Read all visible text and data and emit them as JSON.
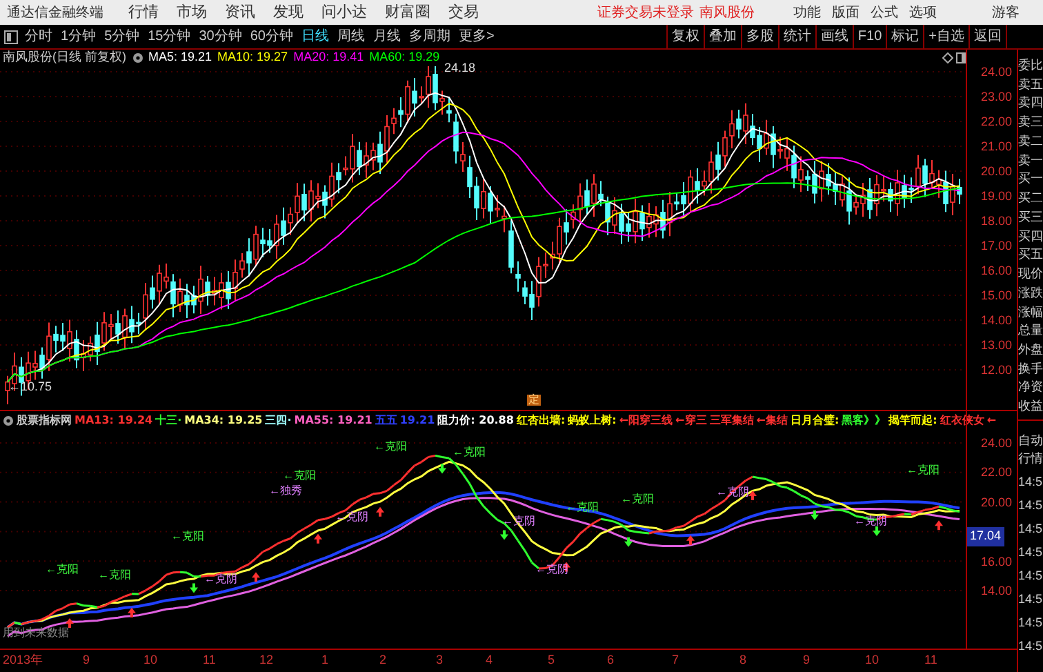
{
  "app": {
    "title": "通达信金融终端",
    "menus": [
      "行情",
      "市场",
      "资讯",
      "发现",
      "问小达",
      "财富圈",
      "交易"
    ],
    "login_notice": "证券交易未登录",
    "stock_link": "南风股份",
    "tools": [
      "功能",
      "版面",
      "公式",
      "选项"
    ],
    "user": "游客"
  },
  "toolbar": {
    "periods": [
      {
        "label": "分时",
        "selected": false
      },
      {
        "label": "1分钟",
        "selected": false
      },
      {
        "label": "5分钟",
        "selected": false
      },
      {
        "label": "15分钟",
        "selected": false
      },
      {
        "label": "30分钟",
        "selected": false
      },
      {
        "label": "60分钟",
        "selected": false
      },
      {
        "label": "日线",
        "selected": true
      },
      {
        "label": "周线",
        "selected": false
      },
      {
        "label": "月线",
        "selected": false
      },
      {
        "label": "多周期",
        "selected": false
      },
      {
        "label": "更多>",
        "selected": false
      }
    ],
    "buttons": [
      "复权",
      "叠加",
      "多股",
      "统计",
      "画线",
      "F10",
      "标记",
      "+自选",
      "返回"
    ]
  },
  "main_chart": {
    "title": "南风股份(日线 前复权)",
    "ma": [
      {
        "label": "MA5: 19.21",
        "color": "#ffffff"
      },
      {
        "label": "MA10: 19.27",
        "color": "#ffff00"
      },
      {
        "label": "MA20: 19.41",
        "color": "#ff00ff"
      },
      {
        "label": "MA60: 19.29",
        "color": "#00ff00"
      }
    ],
    "high_label": "24.18",
    "low_label": "←10.75",
    "marker": "定",
    "price_axis": [
      "24.00",
      "23.00",
      "22.00",
      "21.00",
      "20.00",
      "19.00",
      "18.00",
      "17.00",
      "16.00",
      "15.00",
      "14.00",
      "13.00",
      "12.00"
    ]
  },
  "indicator_chart": {
    "title": "股票指标网",
    "items": [
      {
        "text": "MA13: 19.24",
        "color": "#ff3030"
      },
      {
        "text": "十三·",
        "color": "#30ff30"
      },
      {
        "text": "MA34: 19.25",
        "color": "#ffff80"
      },
      {
        "text": "三四·",
        "color": "#a0ffff"
      },
      {
        "text": "MA55: 19.21",
        "color": "#ff60c0"
      },
      {
        "text": "五五",
        "color": "#3040ff"
      },
      {
        "text": "19.21",
        "color": "#3040ff"
      },
      {
        "text": "阻力价: 20.88",
        "color": "#ffffff"
      },
      {
        "text": "红杏出墙:",
        "color": "#ffff00"
      },
      {
        "text": "蚂蚁上树:",
        "color": "#ffff00"
      },
      {
        "text": "←阳穿三线",
        "color": "#ff3030"
      },
      {
        "text": "←穿三",
        "color": "#ff3030"
      },
      {
        "text": "三军集结",
        "color": "#ff3030"
      },
      {
        "text": "←集结",
        "color": "#ff3030"
      },
      {
        "text": "日月合璧:",
        "color": "#ffff00"
      },
      {
        "text": "黑客》》",
        "color": "#30ff30"
      },
      {
        "text": "揭竿而起:",
        "color": "#ffff00"
      },
      {
        "text": "红衣侠女",
        "color": "#ff3030"
      },
      {
        "text": "←",
        "color": "#ff3030"
      }
    ],
    "labels": [
      {
        "text": "←克阳",
        "kind": "up"
      },
      {
        "text": "←克阳",
        "kind": "up"
      },
      {
        "text": "←克阳",
        "kind": "up"
      },
      {
        "text": "←独秀",
        "kind": "down"
      },
      {
        "text": "←克阳",
        "kind": "up"
      },
      {
        "text": "←克阴",
        "kind": "down"
      },
      {
        "text": "←克阳",
        "kind": "up"
      },
      {
        "text": "←克阳",
        "kind": "up"
      },
      {
        "text": "←克阴",
        "kind": "down"
      },
      {
        "text": "←克阴",
        "kind": "down"
      },
      {
        "text": "←克阴",
        "kind": "down"
      },
      {
        "text": "←克阳",
        "kind": "up"
      },
      {
        "text": "←克阳",
        "kind": "up"
      },
      {
        "text": "←克阴",
        "kind": "down"
      },
      {
        "text": "←克阴",
        "kind": "down"
      },
      {
        "text": "←克阳",
        "kind": "up"
      }
    ],
    "axis": [
      "24.00",
      "22.00",
      "20.00",
      "16.00",
      "14.00"
    ],
    "current_price": "17.04",
    "note": "用到未来数据"
  },
  "time_axis": [
    "2013年",
    "9",
    "10",
    "11",
    "12",
    "1",
    "2",
    "3",
    "4",
    "5",
    "6",
    "7",
    "8",
    "9",
    "10",
    "11"
  ],
  "quote_panel": {
    "fields": [
      "委比",
      "卖五",
      "卖四",
      "卖三",
      "卖二",
      "卖一",
      "买一",
      "买二",
      "买三",
      "买四",
      "买五",
      "现价",
      "涨跌",
      "涨幅",
      "总量",
      "外盘",
      "换手",
      "净资",
      "收益"
    ],
    "modes": [
      "自动",
      "行情"
    ],
    "times": [
      "14:5",
      "14:5",
      "14:5",
      "14:5",
      "14:5",
      "14:5",
      "14:5",
      "14:5"
    ]
  }
}
